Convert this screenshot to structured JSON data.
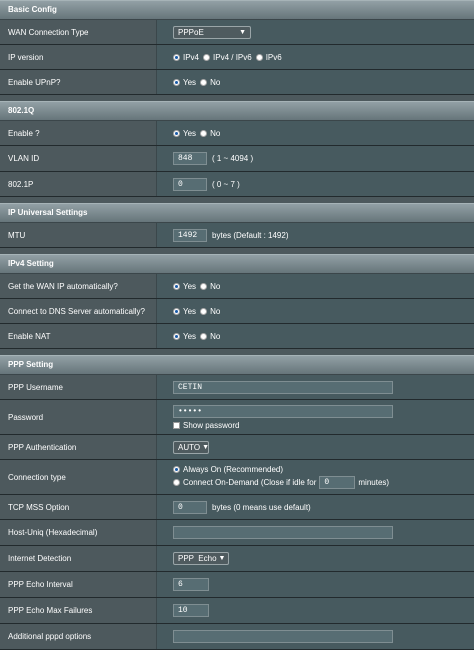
{
  "basic": {
    "title": "Basic Config",
    "wan_type_label": "WAN Connection Type",
    "wan_type_value": "PPPoE",
    "ip_version_label": "IP version",
    "ip_options": [
      "IPv4",
      "IPv4 / IPv6",
      "IPv6"
    ],
    "upnp_label": "Enable UPnP?",
    "yes": "Yes",
    "no": "No"
  },
  "dot1q": {
    "title": "802.1Q",
    "enable_label": "Enable ?",
    "vlan_label": "VLAN ID",
    "vlan_value": "848",
    "vlan_hint": "( 1 ~ 4094 )",
    "p_label": "802.1P",
    "p_value": "0",
    "p_hint": "( 0 ~ 7 )"
  },
  "ipu": {
    "title": "IP Universal Settings",
    "mtu_label": "MTU",
    "mtu_value": "1492",
    "mtu_hint": "bytes (Default : 1492)"
  },
  "ipv4": {
    "title": "IPv4 Setting",
    "auto_wan_label": "Get the WAN IP automatically?",
    "dns_label": "Connect to DNS Server automatically?",
    "nat_label": "Enable NAT"
  },
  "ppp": {
    "title": "PPP Setting",
    "username_label": "PPP Username",
    "username_value": "CETIN",
    "password_label": "Password",
    "password_value": "•••••",
    "show_password": "Show password",
    "auth_label": "PPP Authentication",
    "auth_value": "AUTO",
    "conn_type_label": "Connection type",
    "always_on": "Always On (Recommended)",
    "on_demand_prefix": "Connect On-Demand (Close if idle for",
    "idle_value": "0",
    "idle_suffix": "minutes)",
    "mss_label": "TCP MSS Option",
    "mss_value": "0",
    "mss_hint": "bytes (0 means use default)",
    "hostuniq_label": "Host-Uniq (Hexadecimal)",
    "detect_label": "Internet Detection",
    "detect_value": "PPP  Echo",
    "echo_interval_label": "PPP Echo Interval",
    "echo_interval_value": "6",
    "echo_fail_label": "PPP Echo Max Failures",
    "echo_fail_value": "10",
    "extra_label": "Additional pppd options"
  }
}
